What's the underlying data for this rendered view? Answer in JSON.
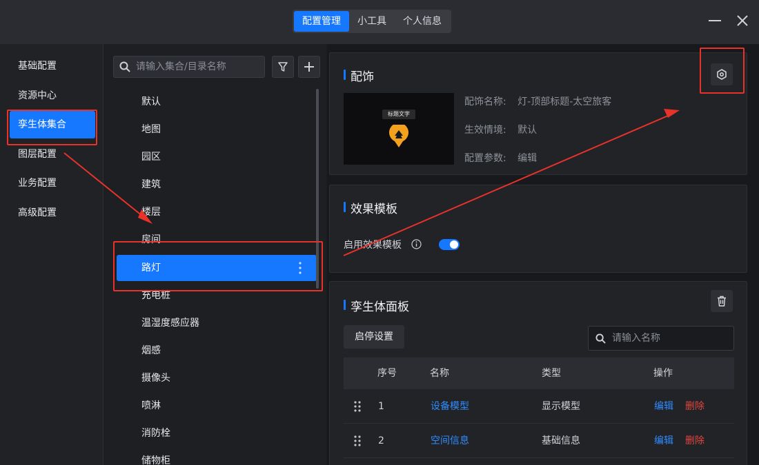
{
  "tabs": [
    {
      "label": "配置管理",
      "active": true
    },
    {
      "label": "小工具",
      "active": false
    },
    {
      "label": "个人信息",
      "active": false
    }
  ],
  "leftnav": [
    {
      "label": "基础配置",
      "active": false
    },
    {
      "label": "资源中心",
      "active": false
    },
    {
      "label": "孪生体集合",
      "active": true
    },
    {
      "label": "图层配置",
      "active": false
    },
    {
      "label": "业务配置",
      "active": false
    },
    {
      "label": "高级配置",
      "active": false
    }
  ],
  "midlist": {
    "search_placeholder": "请输入集合/目录名称",
    "items": [
      "默认",
      "地图",
      "园区",
      "建筑",
      "楼层",
      "房间",
      "路灯",
      "充电桩",
      "温湿度感应器",
      "烟感",
      "摄像头",
      "喷淋",
      "消防栓",
      "储物柜"
    ],
    "selected": "路灯"
  },
  "decoration": {
    "title": "配饰",
    "thumb_label": "标题文字",
    "name_label": "配饰名称:",
    "name_value": "灯-顶部标题-太空旅客",
    "scene_label": "生效情境:",
    "scene_value": "默认",
    "params_label": "配置参数:",
    "params_value": "编辑"
  },
  "effect": {
    "title": "效果模板",
    "enable_label": "启用效果模板",
    "enabled": true
  },
  "twin_panel": {
    "title": "孪生体面板",
    "toggle_button": "启停设置",
    "search_placeholder": "请输入名称",
    "columns": [
      "序号",
      "名称",
      "类型",
      "操作"
    ],
    "rows": [
      {
        "index": "1",
        "name": "设备模型",
        "type": "显示模型",
        "edit": "编辑",
        "delete": "删除"
      },
      {
        "index": "2",
        "name": "空间信息",
        "type": "基础信息",
        "edit": "编辑",
        "delete": "删除"
      }
    ]
  },
  "colors": {
    "accent": "#1677ff",
    "highlight": "#e8322a",
    "danger": "#e0473f",
    "link": "#2f8cff"
  }
}
